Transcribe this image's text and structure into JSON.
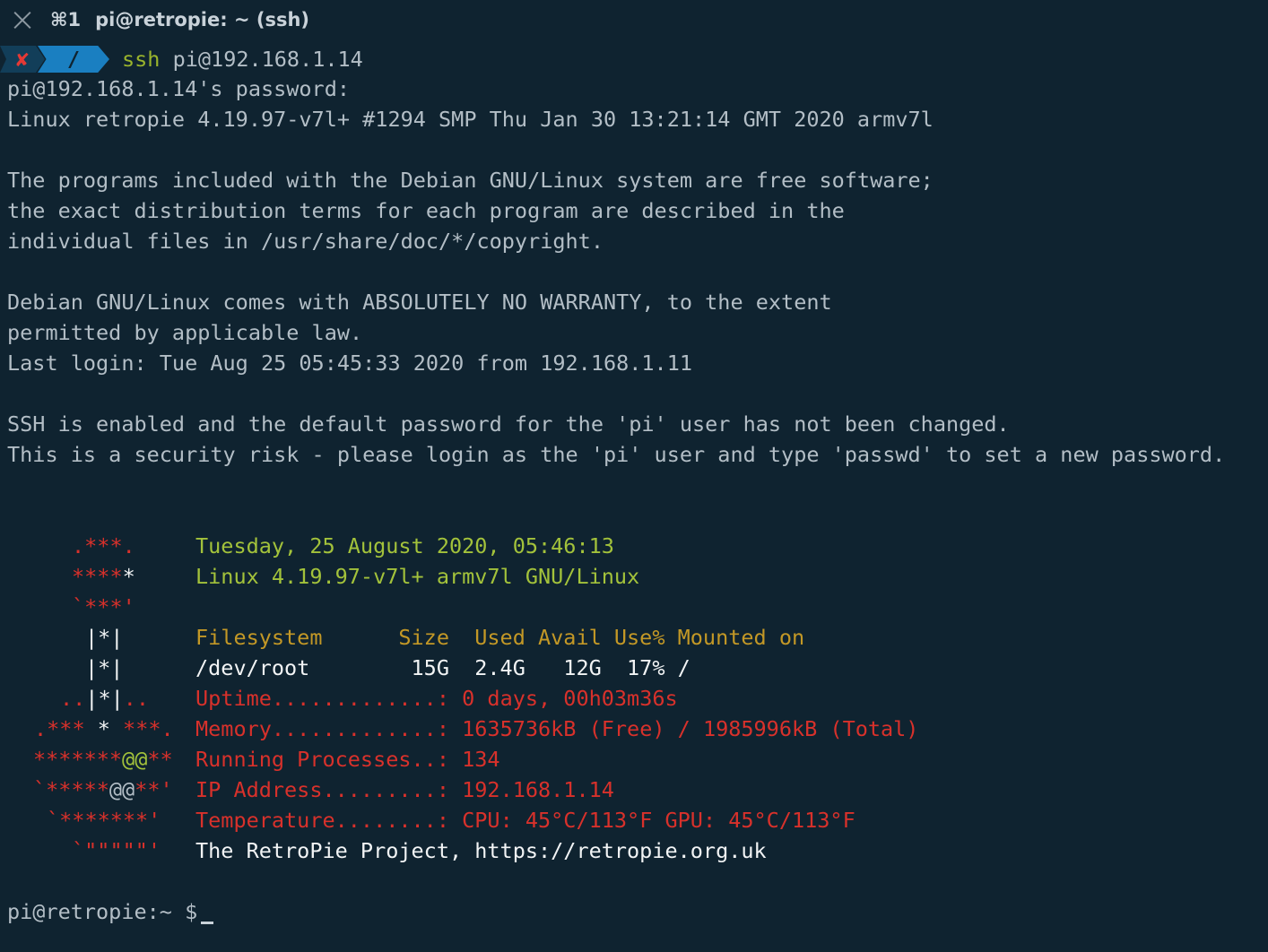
{
  "window": {
    "shortcut": "⌘1",
    "title": "pi@retropie: ~ (ssh)"
  },
  "prompt": {
    "status_symbol": "✘",
    "directory": "/",
    "command": "ssh",
    "args": " pi@192.168.1.14"
  },
  "output": {
    "password_prompt": "pi@192.168.1.14's password:",
    "kernel_line": "Linux retropie 4.19.97-v7l+ #1294 SMP Thu Jan 30 13:21:14 GMT 2020 armv7l",
    "license_1": "The programs included with the Debian GNU/Linux system are free software;",
    "license_2": "the exact distribution terms for each program are described in the",
    "license_3": "individual files in /usr/share/doc/*/copyright.",
    "warranty_1": "Debian GNU/Linux comes with ABSOLUTELY NO WARRANTY, to the extent",
    "warranty_2": "permitted by applicable law.",
    "last_login": "Last login: Tue Aug 25 05:45:33 2020 from 192.168.1.11",
    "ssh_warning_1": "SSH is enabled and the default password for the 'pi' user has not been changed.",
    "ssh_warning_2": "This is a security risk - please login as the 'pi' user and type 'passwd' to set a new password."
  },
  "motd": {
    "date": "Tuesday, 25 August 2020, 05:46:13",
    "system": "Linux 4.19.97-v7l+ armv7l GNU/Linux",
    "df_header": "Filesystem      Size  Used Avail Use% Mounted on",
    "df_row": "/dev/root        15G  2.4G   12G  17% /",
    "uptime_label": "Uptime.............: ",
    "uptime_value": "0 days, 00h03m36s",
    "memory_label": "Memory.............: ",
    "memory_value": "1635736kB (Free) / 1985996kB (Total)",
    "processes_label": "Running Processes..: ",
    "processes_value": "134",
    "ip_label": "IP Address.........: ",
    "ip_value": "192.168.1.14",
    "temp_label": "Temperature........: ",
    "temp_value": "CPU: 45°C/113°F GPU: 45°C/113°F",
    "project": "The RetroPie Project, https://retropie.org.uk"
  },
  "art": {
    "r1": ".***.",
    "r2a": "****",
    "r2b": "*",
    "r3": "`***'",
    "r4": "|*|",
    "r5": "|*|",
    "r6a": "..",
    "r6b": "|*|",
    "r6c": "..",
    "r7a": ".***",
    "r7b": " * ",
    "r7c": "***.",
    "r8a": "*******",
    "r8b": "@@",
    "r8c": "**",
    "r9a": "`*****",
    "r9b": "@@",
    "r9c": "**'",
    "r10": "`*******'",
    "r11": "`\"\"\"\"\"'"
  },
  "final_prompt": {
    "text": "pi@retropie:~ $"
  },
  "colors": {
    "background": "#0f2330",
    "text": "#b3bec6",
    "motd_green": "#a3c23b",
    "motd_gold": "#c39826",
    "motd_red": "#d8312b",
    "prompt_cmd": "#9ab42c"
  }
}
